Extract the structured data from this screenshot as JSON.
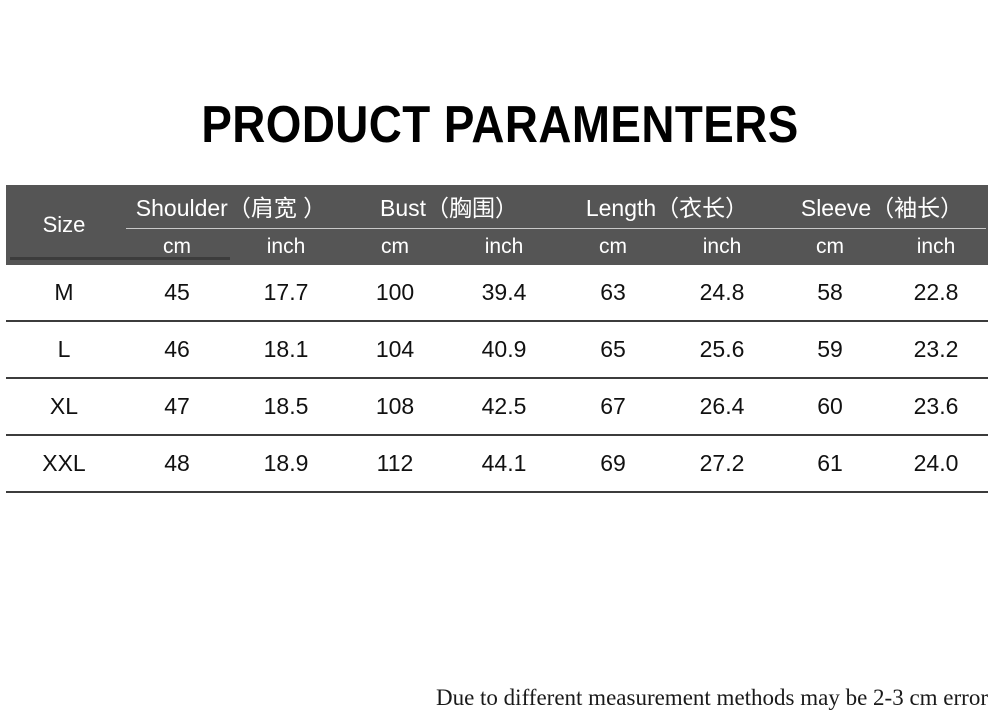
{
  "title": "PRODUCT PARAMENTERS",
  "table": {
    "size_header": "Size",
    "groups": [
      {
        "label": "Shoulder（肩宽 ）",
        "units": [
          "cm",
          "inch"
        ]
      },
      {
        "label": "Bust（胸围）",
        "units": [
          "cm",
          "inch"
        ]
      },
      {
        "label": "Length（衣长）",
        "units": [
          "cm",
          "inch"
        ]
      },
      {
        "label": "Sleeve（袖长）",
        "units": [
          "cm",
          "inch"
        ]
      }
    ],
    "column_headers": [
      "Size",
      "cm",
      "inch",
      "cm",
      "inch",
      "cm",
      "inch",
      "cm",
      "inch"
    ],
    "rows": [
      {
        "size": "M",
        "shoulder_cm": "45",
        "shoulder_inch": "17.7",
        "bust_cm": "100",
        "bust_inch": "39.4",
        "length_cm": "63",
        "length_inch": "24.8",
        "sleeve_cm": "58",
        "sleeve_inch": "22.8"
      },
      {
        "size": "L",
        "shoulder_cm": "46",
        "shoulder_inch": "18.1",
        "bust_cm": "104",
        "bust_inch": "40.9",
        "length_cm": "65",
        "length_inch": "25.6",
        "sleeve_cm": "59",
        "sleeve_inch": "23.2"
      },
      {
        "size": "XL",
        "shoulder_cm": "47",
        "shoulder_inch": "18.5",
        "bust_cm": "108",
        "bust_inch": "42.5",
        "length_cm": "67",
        "length_inch": "26.4",
        "sleeve_cm": "60",
        "sleeve_inch": "23.6"
      },
      {
        "size": "XXL",
        "shoulder_cm": "48",
        "shoulder_inch": "18.9",
        "bust_cm": "112",
        "bust_inch": "44.1",
        "length_cm": "69",
        "length_inch": "27.2",
        "sleeve_cm": "61",
        "sleeve_inch": "24.0"
      }
    ]
  },
  "note": "Due to different measurement methods may be 2-3 cm error",
  "colors": {
    "header_background": "#555555",
    "header_text": "#ffffff",
    "page_background": "#ffffff",
    "row_divider": "#3c3c3c",
    "group_divider": "#c9c9c9",
    "body_text": "#111111"
  }
}
